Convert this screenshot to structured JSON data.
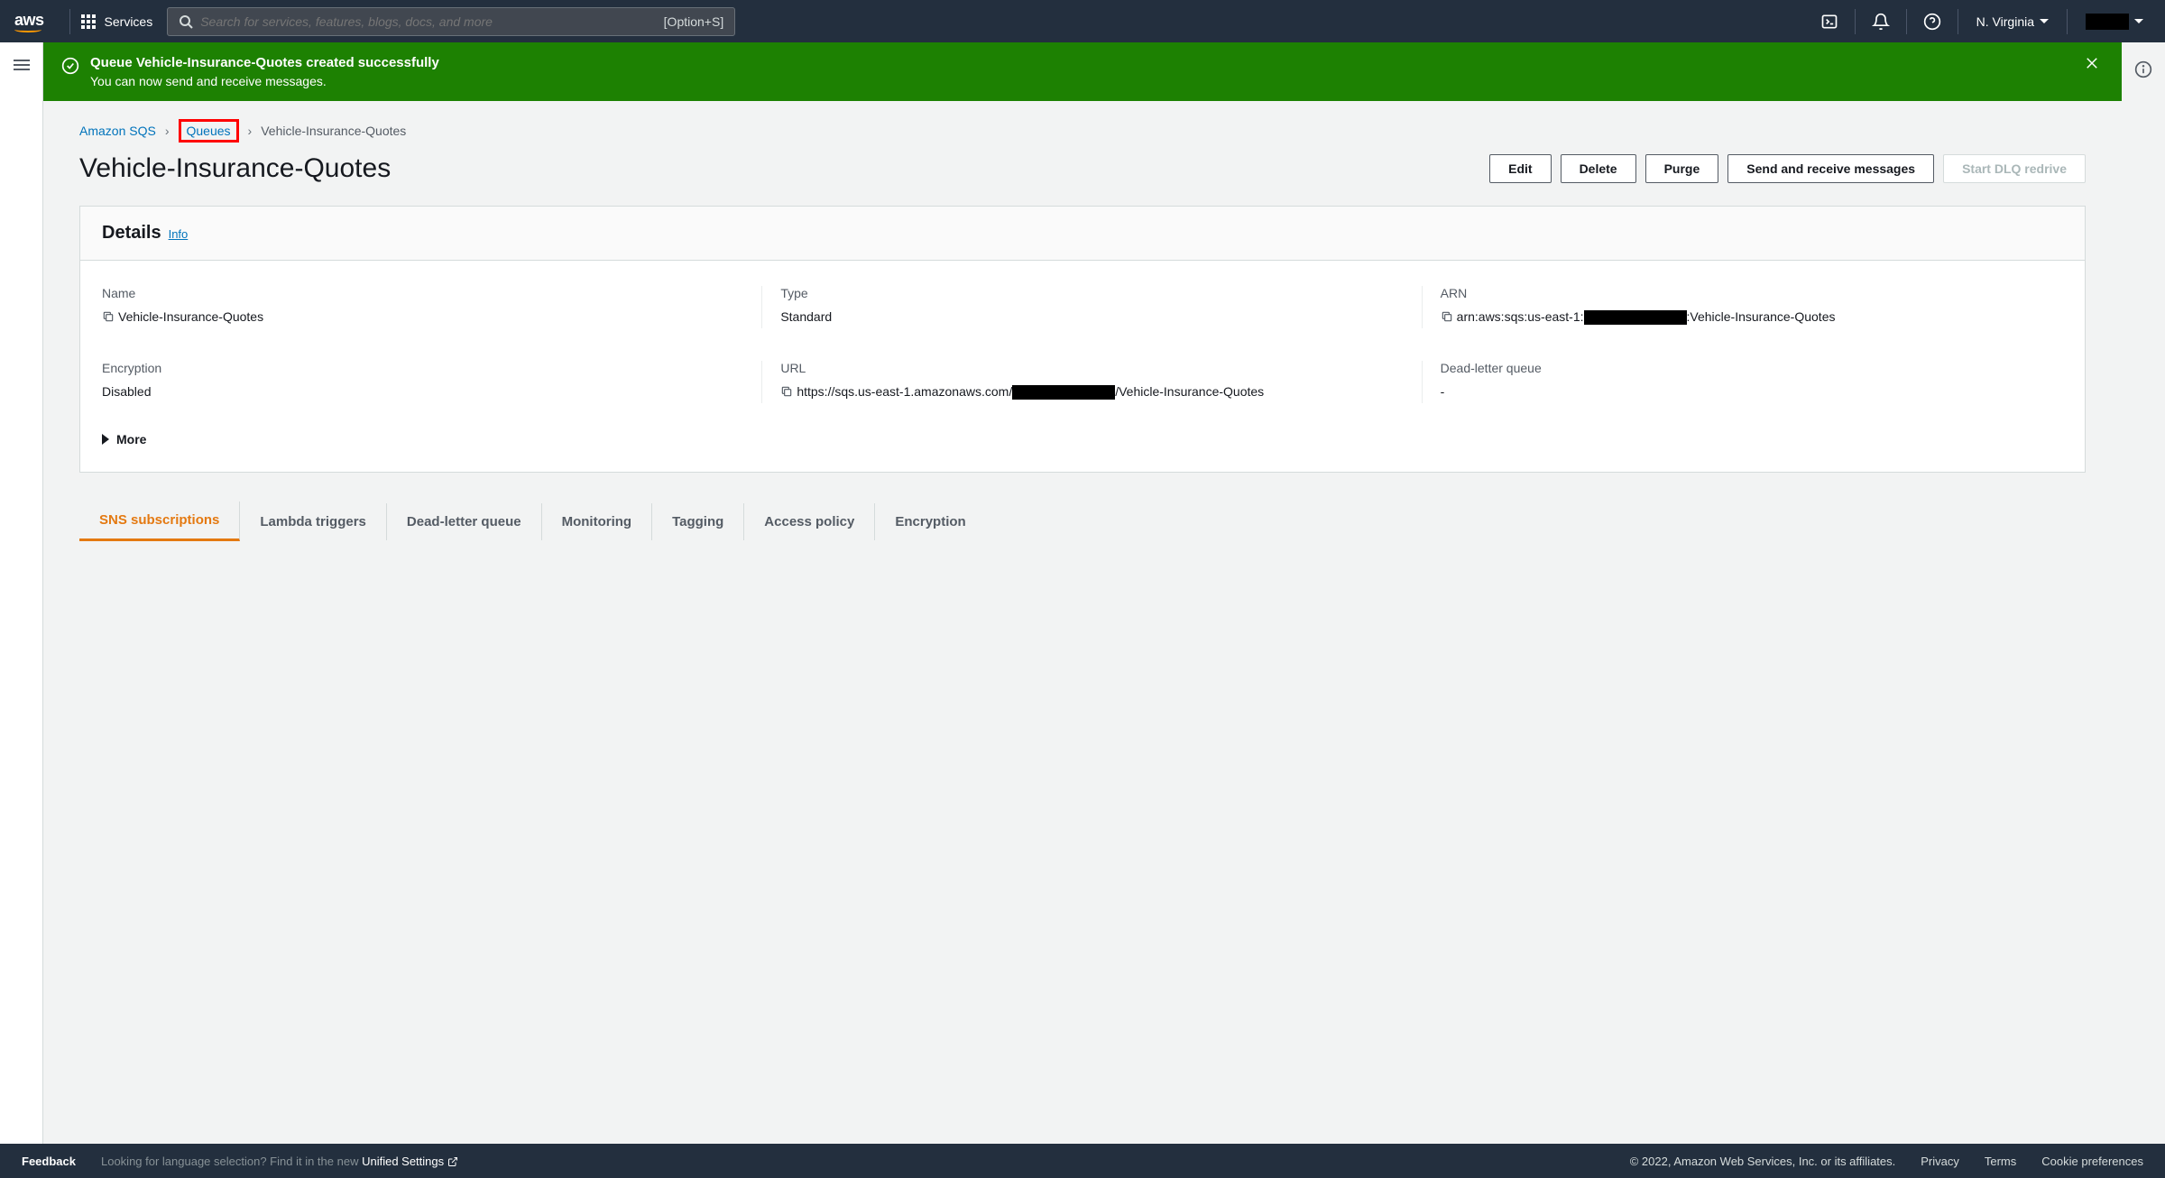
{
  "topnav": {
    "logo": "aws",
    "services_label": "Services",
    "search_placeholder": "Search for services, features, blogs, docs, and more",
    "search_shortcut": "[Option+S]",
    "region": "N. Virginia"
  },
  "notification": {
    "title": "Queue Vehicle-Insurance-Quotes created successfully",
    "subtitle": "You can now send and receive messages."
  },
  "breadcrumb": {
    "root": "Amazon SQS",
    "queues": "Queues",
    "current": "Vehicle-Insurance-Quotes"
  },
  "page": {
    "title": "Vehicle-Insurance-Quotes",
    "actions": {
      "edit": "Edit",
      "delete": "Delete",
      "purge": "Purge",
      "send_receive": "Send and receive messages",
      "dlq_redrive": "Start DLQ redrive"
    }
  },
  "details": {
    "header": "Details",
    "info": "Info",
    "name_label": "Name",
    "name_value": "Vehicle-Insurance-Quotes",
    "type_label": "Type",
    "type_value": "Standard",
    "arn_label": "ARN",
    "arn_prefix": "arn:aws:sqs:us-east-1:",
    "arn_suffix": ":Vehicle-Insurance-Quotes",
    "encryption_label": "Encryption",
    "encryption_value": "Disabled",
    "url_label": "URL",
    "url_prefix": "https://sqs.us-east-1.amazonaws.com/",
    "url_suffix": "/Vehicle-Insurance-Quotes",
    "dlq_label": "Dead-letter queue",
    "dlq_value": "-",
    "more": "More"
  },
  "tabs": [
    "SNS subscriptions",
    "Lambda triggers",
    "Dead-letter queue",
    "Monitoring",
    "Tagging",
    "Access policy",
    "Encryption"
  ],
  "footer": {
    "feedback": "Feedback",
    "lang_hint_pre": "Looking for language selection? Find it in the new ",
    "lang_hint_link": "Unified Settings",
    "copyright": "© 2022, Amazon Web Services, Inc. or its affiliates.",
    "privacy": "Privacy",
    "terms": "Terms",
    "cookies": "Cookie preferences"
  }
}
